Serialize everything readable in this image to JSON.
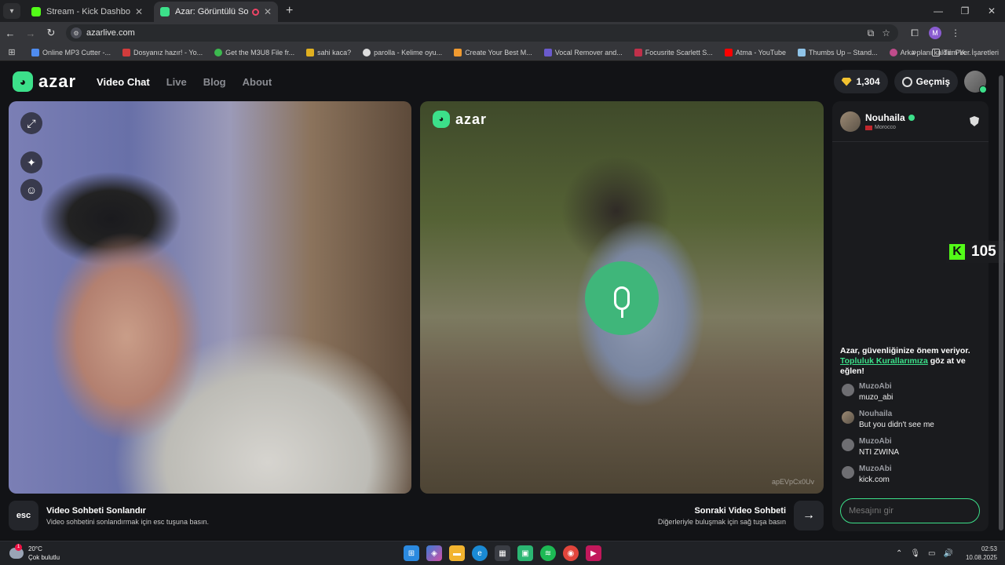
{
  "browser": {
    "tabs": [
      {
        "title": "Stream - Kick Dashboard",
        "active": false
      },
      {
        "title": "Azar: Görüntülü Sohbet, Ar",
        "active": true
      }
    ],
    "url": "azarlive.com",
    "bookmarks": [
      "Online MP3 Cutter -...",
      "Dosyanız hazır! - Yo...",
      "Get the M3U8 File fr...",
      "sahi kaca?",
      "parolla - Kelime oyu...",
      "Create Your Best M...",
      "Vocal Remover and...",
      "Focusrite Scarlett S...",
      "Atma - YouTube",
      "Thumbs Up – Stand...",
      "Arka planı kaldır: Pix..."
    ],
    "all_bookmarks": "Tüm Yer İşaretleri",
    "profile_initial": "M"
  },
  "nav": {
    "logo": "azar",
    "menu": [
      {
        "label": "Video Chat",
        "active": true
      },
      {
        "label": "Live",
        "active": false
      },
      {
        "label": "Blog",
        "active": false
      },
      {
        "label": "About",
        "active": false
      }
    ],
    "gems": "1,304",
    "history": "Geçmiş"
  },
  "remote": {
    "logo": "azar",
    "watermark": "apEVpCx0Uv"
  },
  "kick_badge": {
    "letter": "K",
    "count": "105"
  },
  "chat": {
    "partner_name": "Nouhaila",
    "partner_country": "Morocco",
    "notice_before": "Azar, güvenliğinize önem veriyor.",
    "notice_link": "Topluluk Kurallarımıza",
    "notice_after": "göz at ve eğlen!",
    "messages": [
      {
        "user": "MuzoAbi",
        "text": "muzo_abi"
      },
      {
        "user": "Nouhaila",
        "text": "But you didn't see me"
      },
      {
        "user": "MuzoAbi",
        "text": "NTI ZWINA"
      },
      {
        "user": "MuzoAbi",
        "text": "kick.com"
      }
    ],
    "input_placeholder": "Mesajını gir"
  },
  "hints": {
    "left_key": "esc",
    "left_title": "Video Sohbeti Sonlandır",
    "left_sub": "Video sohbetini sonlandırmak için esc tuşuna basın.",
    "right_title": "Sonraki Video Sohbeti",
    "right_sub": "Diğerleriyle buluşmak için sağ tuşa basın",
    "right_key": "→"
  },
  "taskbar": {
    "temperature": "20°C",
    "weather": "Çok bulutlu",
    "weather_badge": "1",
    "time": "02:53",
    "date": "10.08.2025"
  },
  "colors": {
    "accent": "#3ce08a",
    "kick": "#53fc18",
    "gem": "#f2c230"
  }
}
